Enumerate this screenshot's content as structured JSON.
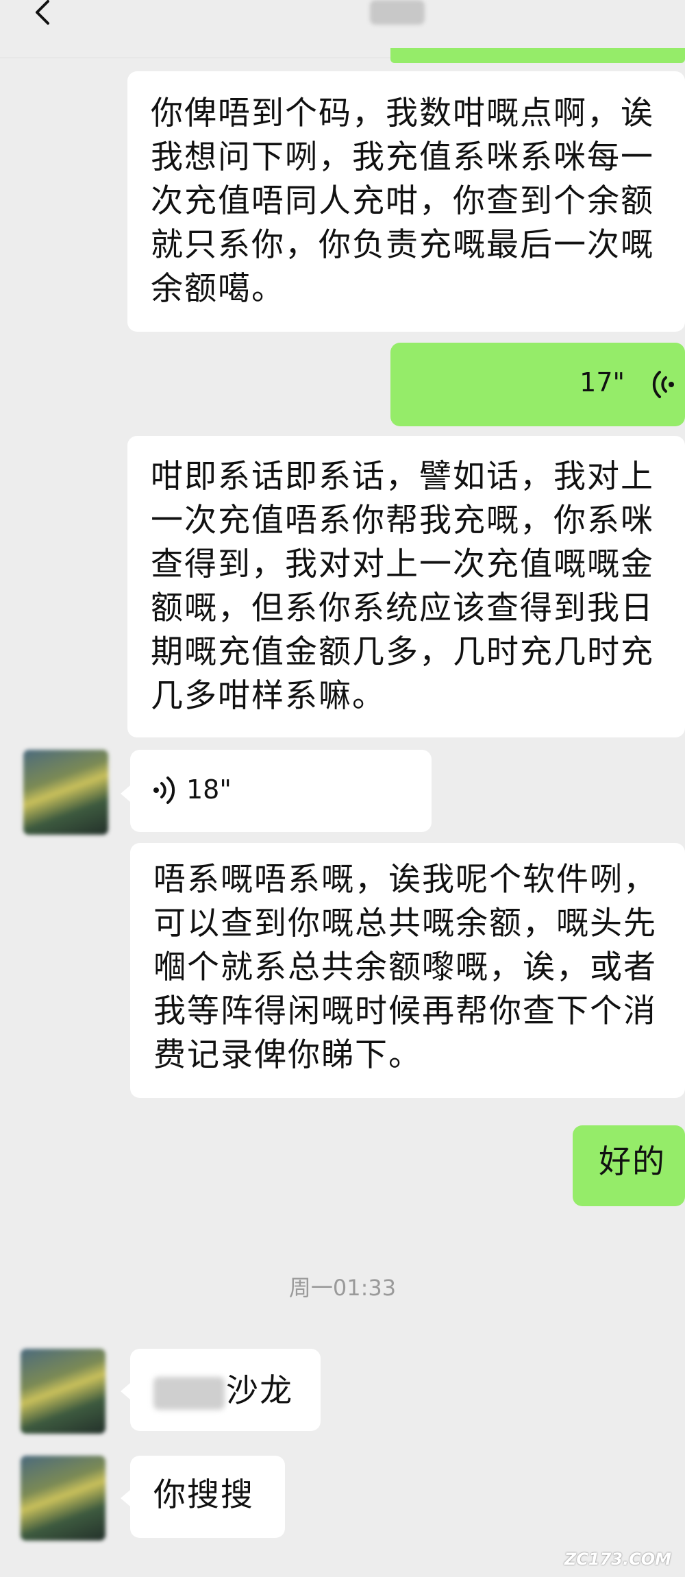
{
  "header": {
    "back_icon": "chevron-left-icon"
  },
  "messages": {
    "m1": "你俾唔到个码，我数咁嘅点啊，诶\n我想问下咧，我充值系咪系咪每一\n次充值唔同人充咁，你查到个余额\n就只系你，你负责充嘅最后一次嘅\n余额噶。",
    "m2_duration": "17\"",
    "m3": "咁即系话即系话，譬如话，我对上\n一次充值唔系你帮我充嘅，你系咪\n查得到，我对对上一次充值嘅嘅金\n额嘅，但系你系统应该查得到我日\n期嘅充值金额几多，几时充几时充\n几多咁样系嘛。",
    "m4_duration": "18\"",
    "m5": "唔系嘅唔系嘅，诶我呢个软件咧，\n可以查到你嘅总共嘅余额，嘅头先\n嗰个就系总共余额嚟嘅，诶，或者\n我等阵得闲嘅时候再帮你查下个消\n费记录俾你睇下。",
    "m6": "好的",
    "timestamp": "周一01:33",
    "m7_suffix": "沙龙",
    "m8": "你搜搜"
  },
  "watermark": "ZC173.COM",
  "colors": {
    "background": "#ededed",
    "outgoing_bubble": "#95ec69",
    "incoming_bubble": "#ffffff",
    "timestamp_text": "#9a9a9a"
  }
}
